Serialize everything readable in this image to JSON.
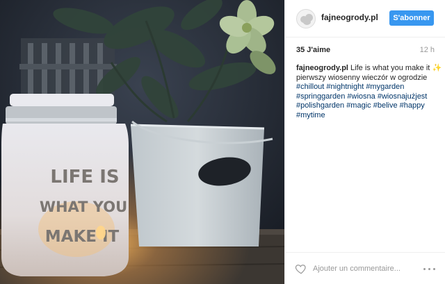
{
  "post": {
    "username": "fajneogrody.pl",
    "follow_label": "S'abonner",
    "likes": "35 J'aime",
    "time": "12 h",
    "caption": {
      "username": "fajneogrody.pl",
      "text": "Life is what you make it",
      "sparkle": "✨",
      "line2": "pierwszy wiosenny wieczór w ogrodzie",
      "hashtag_lines": [
        [
          "#chillout",
          "#nightnight",
          "#mygarden"
        ],
        [
          "#springgarden",
          "#wiosna",
          "#wiosnajużjest"
        ],
        [
          "#polishgarden",
          "#magic",
          "#belive",
          "#happy"
        ],
        [
          "#mytime"
        ]
      ]
    },
    "comment_placeholder": "Ajouter un commentaire...",
    "photo": {
      "lantern_text": [
        "LIFE IS",
        "WHAT YOU",
        "MAKE IT"
      ]
    }
  },
  "colors": {
    "accent": "#3897f0",
    "hashtag": "#003569",
    "muted": "#999999",
    "text": "#262626"
  },
  "icons": {
    "like": "heart-outline-icon",
    "more": "ellipsis-icon"
  }
}
